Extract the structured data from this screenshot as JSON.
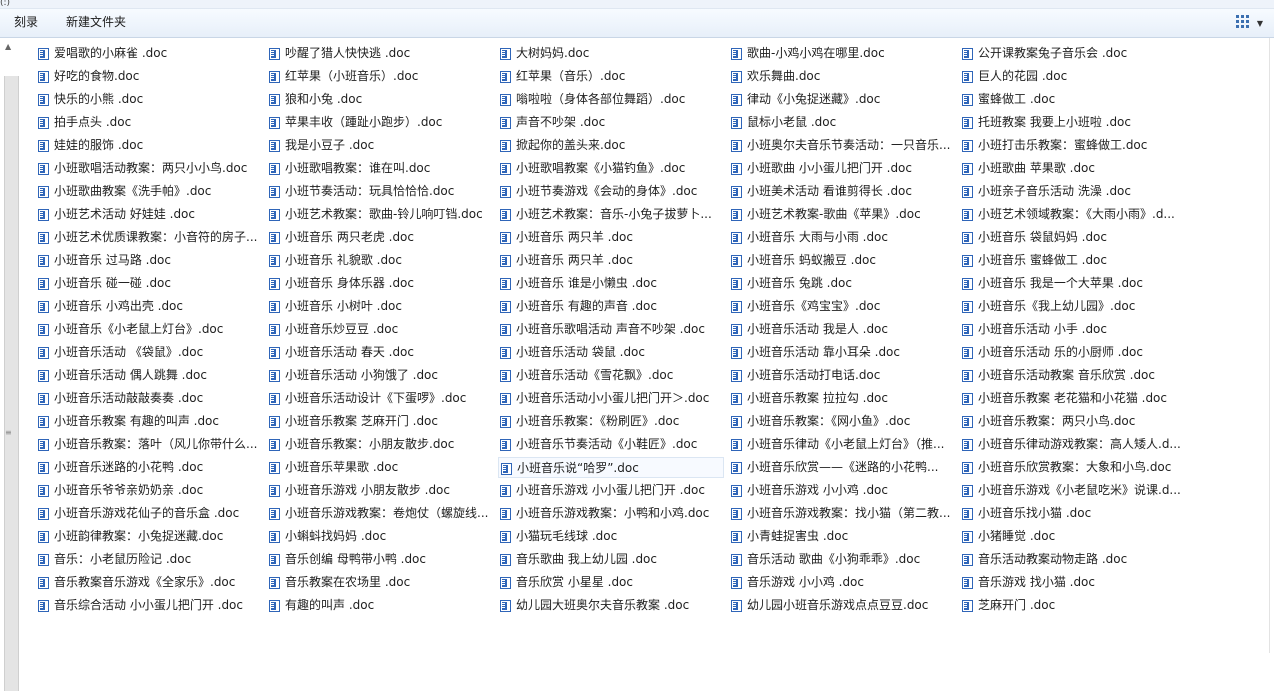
{
  "window": {
    "top_text": "(:)"
  },
  "toolbar": {
    "burn_label": "刻录",
    "new_folder_label": "新建文件夹"
  },
  "files": {
    "columns": [
      [
        "爱唱歌的小麻雀 .doc",
        "好吃的食物.doc",
        "快乐的小熊 .doc",
        "拍手点头 .doc",
        "娃娃的服饰 .doc",
        "小班歌唱活动教案：两只小小鸟.doc",
        "小班歌曲教案《洗手帕》.doc",
        "小班艺术活动 好娃娃 .doc",
        "小班艺术优质课教案：小音符的房子...",
        "小班音乐 过马路 .doc",
        "小班音乐 碰一碰 .doc",
        "小班音乐 小鸡出壳 .doc",
        "小班音乐《小老鼠上灯台》.doc",
        "小班音乐活动 《袋鼠》.doc",
        "小班音乐活动 偶人跳舞 .doc",
        "小班音乐活动敲敲奏奏 .doc",
        "小班音乐教案 有趣的叫声 .doc",
        "小班音乐教案：落叶（风儿你带什么...",
        "小班音乐迷路的小花鸭 .doc",
        "小班音乐爷爷亲奶奶亲 .doc",
        "小班音乐游戏花仙子的音乐盒 .doc",
        "小班韵律教案：小兔捉迷藏.doc",
        "音乐：小老鼠历险记 .doc",
        "音乐教案音乐游戏《全家乐》.doc",
        "音乐综合活动  小小蛋儿把门开 .doc"
      ],
      [
        "吵醒了猎人快快逃 .doc",
        "红苹果（小班音乐）.doc",
        "狼和小兔 .doc",
        "苹果丰收（踵趾小跑步）.doc",
        "我是小豆子 .doc",
        "小班歌唱教案：谁在叫.doc",
        "小班节奏活动：玩具恰恰恰.doc",
        "小班艺术教案：歌曲-铃儿响叮铛.doc",
        "小班音乐  两只老虎 .doc",
        "小班音乐 礼貌歌 .doc",
        "小班音乐 身体乐器 .doc",
        "小班音乐 小树叶 .doc",
        "小班音乐炒豆豆 .doc",
        "小班音乐活动 春天 .doc",
        "小班音乐活动 小狗饿了 .doc",
        "小班音乐活动设计《下蛋啰》.doc",
        "小班音乐教案 芝麻开门 .doc",
        "小班音乐教案：小朋友散步.doc",
        "小班音乐苹果歌 .doc",
        "小班音乐游戏 小朋友散步 .doc",
        "小班音乐游戏教案：卷炮仗（螺旋线...",
        "小蝌蚪找妈妈 .doc",
        "音乐创编  母鸭带小鸭 .doc",
        "音乐教案在农场里 .doc",
        "有趣的叫声 .doc"
      ],
      [
        "大树妈妈.doc",
        "红苹果（音乐）.doc",
        "嗡啦啦（身体各部位舞蹈）.doc",
        "声音不吵架 .doc",
        "掀起你的盖头来.doc",
        "小班歌唱教案《小猫钓鱼》.doc",
        "小班节奏游戏《会动的身体》.doc",
        "小班艺术教案：音乐-小兔子拔萝卜...",
        "小班音乐  两只羊 .doc",
        "小班音乐 两只羊 .doc",
        "小班音乐 谁是小懒虫 .doc",
        "小班音乐 有趣的声音 .doc",
        "小班音乐歌唱活动  声音不吵架 .doc",
        "小班音乐活动 袋鼠 .doc",
        "小班音乐活动《雪花飘》.doc",
        "小班音乐活动小小蛋儿把门开＞.doc",
        "小班音乐教案：《粉刷匠》.doc",
        "小班音乐节奏活动《小鞋匠》.doc",
        "小班音乐说“哈罗”.doc",
        "小班音乐游戏 小小蛋儿把门开 .doc",
        "小班音乐游戏教案：小鸭和小鸡.doc",
        "小猫玩毛线球 .doc",
        "音乐歌曲 我上幼儿园 .doc",
        "音乐欣赏 小星星 .doc",
        "幼儿园大班奥尔夫音乐教案 .doc"
      ],
      [
        "歌曲-小鸡小鸡在哪里.doc",
        "欢乐舞曲.doc",
        "律动《小兔捉迷藏》.doc",
        "鼠标小老鼠 .doc",
        "小班奥尔夫音乐节奏活动：一只音乐...",
        "小班歌曲  小小蛋儿把门开 .doc",
        "小班美术活动 看谁剪得长 .doc",
        "小班艺术教案-歌曲《苹果》.doc",
        "小班音乐 大雨与小雨 .doc",
        "小班音乐 蚂蚁搬豆 .doc",
        "小班音乐 兔跳 .doc",
        "小班音乐《鸡宝宝》.doc",
        "小班音乐活动  我是人 .doc",
        "小班音乐活动 靠小耳朵 .doc",
        "小班音乐活动打电话.doc",
        "小班音乐教案 拉拉勾 .doc",
        "小班音乐教案：《网小鱼》.doc",
        "小班音乐律动《小老鼠上灯台》（推...",
        "小班音乐欣赏——《迷路的小花鸭...",
        "小班音乐游戏 小小鸡 .doc",
        "小班音乐游戏教案：找小猫（第二教...",
        "小青蛙捉害虫 .doc",
        "音乐活动  歌曲《小狗乖乖》.doc",
        "音乐游戏 小小鸡 .doc",
        "幼儿园小班音乐游戏点点豆豆.doc"
      ],
      [
        "公开课教案兔子音乐会 .doc",
        "巨人的花园 .doc",
        "蜜蜂做工 .doc",
        "托班教案 我要上小班啦 .doc",
        "小班打击乐教案：蜜蜂做工.doc",
        "小班歌曲 苹果歌 .doc",
        "小班亲子音乐活动  洗澡 .doc",
        "小班艺术领域教案：《大雨小雨》.d...",
        "小班音乐 袋鼠妈妈 .doc",
        "小班音乐 蜜蜂做工 .doc",
        "小班音乐 我是一个大苹果 .doc",
        "小班音乐《我上幼儿园》.doc",
        "小班音乐活动  小手 .doc",
        "小班音乐活动 乐的小厨师 .doc",
        "小班音乐活动教案  音乐欣赏 .doc",
        "小班音乐教案 老花猫和小花猫 .doc",
        "小班音乐教案：两只小鸟.doc",
        "小班音乐律动游戏教案：高人矮人.d...",
        "小班音乐欣赏教案：大象和小鸟.doc",
        "小班音乐游戏《小老鼠吃米》说课.d...",
        "小班音乐找小猫 .doc",
        "小猪睡觉 .doc",
        "音乐活动教案动物走路 .doc",
        "音乐游戏 找小猫 .doc",
        "芝麻开门 .doc"
      ]
    ],
    "selected": [
      2,
      18
    ]
  }
}
